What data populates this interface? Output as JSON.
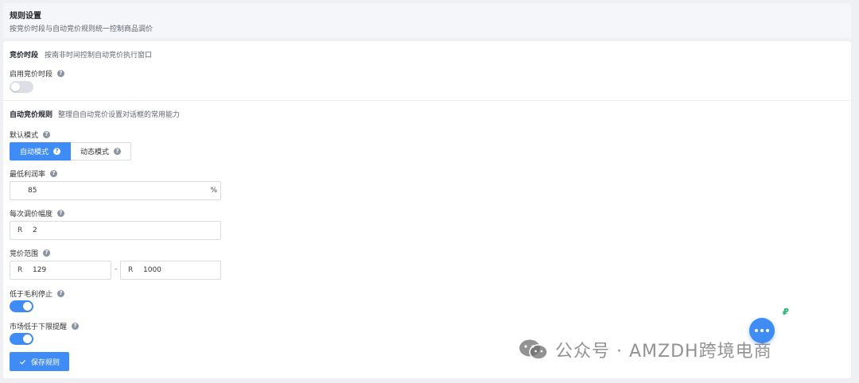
{
  "header": {
    "title": "规则设置",
    "subtitle": "按竞价时段与自动竞价规则统一控制商品调价"
  },
  "bidding_period": {
    "title": "竞价时段",
    "description": "按南非时间控制自动竞价执行窗口",
    "enable_label": "启用竞价时段",
    "enabled": false
  },
  "auto_rules": {
    "title": "自动竞价规则",
    "description": "整理自自动竞价设置对话框的常用能力",
    "default_mode_label": "默认模式",
    "modes": [
      "自动模式",
      "动态模式"
    ],
    "selected_mode": "自动模式",
    "min_margin_label": "最低利润率",
    "min_margin_value": "85",
    "min_margin_suffix": "%",
    "step_label": "每次调价幅度",
    "step_prefix": "R",
    "step_value": "2",
    "range_label": "竞价范围",
    "range_min_prefix": "R",
    "range_min": "129",
    "range_sep": "-",
    "range_max_prefix": "R",
    "range_max": "1000",
    "stop_below_margin_label": "低于毛利停止",
    "stop_below_margin_enabled": true,
    "market_low_alert_label": "市场低于下限提醒",
    "market_low_alert_enabled": true,
    "save_label": "保存规则"
  },
  "watermark": {
    "text": "公众号 · AMZDH跨境电商"
  },
  "colors": {
    "accent": "#3f8cf6",
    "toggle_off": "#dcdfe6",
    "green": "#2bb673"
  },
  "icons": {
    "help": "help-circle-icon",
    "save": "check-icon",
    "fab": "more-horizontal-icon",
    "brand": "wechat-icon"
  }
}
